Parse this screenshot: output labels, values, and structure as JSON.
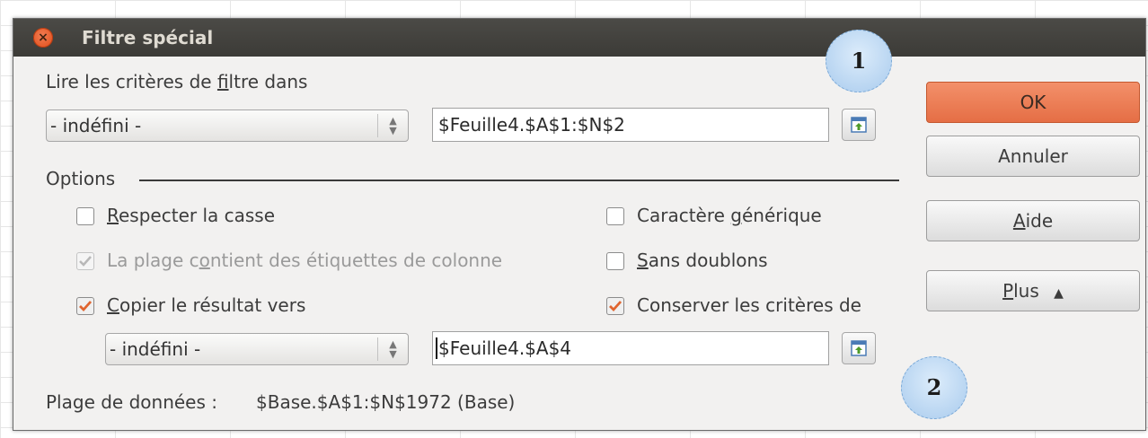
{
  "window": {
    "title": "Filtre spécial",
    "close_icon_glyph": "×"
  },
  "criteria": {
    "label_pre": "Lire les critères de ",
    "label_mnemonic": "f",
    "label_post": "iltre dans",
    "combo_value": "- indéfini -",
    "range_value": "$Feuille4.$A$1:$N$2"
  },
  "options": {
    "heading": "Options",
    "case_sensitive": {
      "mnemonic": "R",
      "rest": "especter la casse",
      "checked": false,
      "enabled": true
    },
    "wildcard": {
      "pre": "Caractère ",
      "mnemonic": "g",
      "post": "énérique",
      "checked": false,
      "enabled": true
    },
    "contains_headers": {
      "pre": "La plage c",
      "mnemonic": "o",
      "post": "ntient des étiquettes de colonne",
      "checked": true,
      "enabled": false
    },
    "no_duplicates": {
      "mnemonic": "S",
      "rest": "ans doublons",
      "checked": false,
      "enabled": true
    },
    "copy_results": {
      "mnemonic": "C",
      "rest": "opier le résultat vers",
      "checked": true,
      "enabled": true
    },
    "keep_criteria": {
      "label": "Conserver les critères de",
      "checked": true,
      "enabled": true
    },
    "copy_combo_value": "- indéfini -",
    "copy_range_value": "$Feuille4.$A$4"
  },
  "data_range": {
    "label": "Plage de données :",
    "value": "$Base.$A$1:$N$1972 (Base)"
  },
  "buttons": {
    "ok": "OK",
    "cancel": "Annuler",
    "help_mnemonic": "A",
    "help_rest": "ide",
    "more_mnemonic": "P",
    "more_rest": "lus",
    "more_icon_glyph": "▲"
  },
  "callouts": [
    "1",
    "2"
  ],
  "colors": {
    "titlebar": "#3c3b37",
    "dialog_bg": "#f2f1f0",
    "ok_button": "#e56e45",
    "check_mark": "#e0652f",
    "callout": "#a9cbed"
  }
}
